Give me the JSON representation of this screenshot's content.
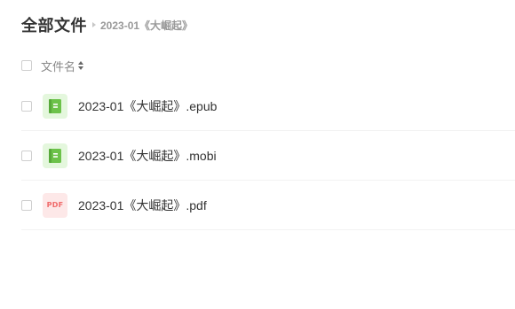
{
  "header": {
    "title": "全部文件",
    "breadcrumb": "2023-01《大崛起》"
  },
  "list": {
    "column_name": "文件名",
    "files": [
      {
        "name": "2023-01《大崛起》.epub",
        "icon": "book-icon"
      },
      {
        "name": "2023-01《大崛起》.mobi",
        "icon": "book-icon"
      },
      {
        "name": "2023-01《大崛起》.pdf",
        "icon": "pdf-icon",
        "icon_text": "PDF"
      }
    ]
  },
  "colors": {
    "book_icon_bg": "#e4f7dd",
    "book_icon_fg": "#6cc24a",
    "pdf_icon_bg": "#fde8e8",
    "pdf_icon_fg": "#f06a6a"
  }
}
